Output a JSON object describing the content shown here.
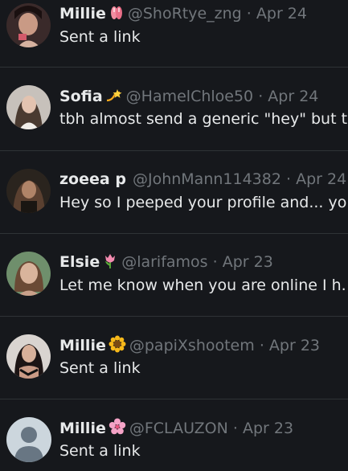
{
  "dm_list": [
    {
      "name": "Millie",
      "emoji": "flip-flops",
      "handle": "@ShoRtye_zng",
      "date": "Apr 24",
      "preview": "Sent a link"
    },
    {
      "name": "Sofia",
      "emoji": "dizzy",
      "handle": "@HamelChloe50",
      "date": "Apr 24",
      "preview": "tbh almost send a generic \"hey\" but t"
    },
    {
      "name": "zoeea p",
      "emoji": "",
      "handle": "@JohnMann114382",
      "date": "Apr 24",
      "preview": "Hey so I peeped your profile and... yo"
    },
    {
      "name": "Elsie",
      "emoji": "tulip",
      "handle": "@larifamos",
      "date": "Apr 23",
      "preview": "Let me know when you are online I h."
    },
    {
      "name": "Millie",
      "emoji": "sunflower",
      "handle": "@papiXshootem",
      "date": "Apr 23",
      "preview": "Sent a link"
    },
    {
      "name": "Millie",
      "emoji": "cherry-blossom",
      "handle": "@FCLAUZON",
      "date": "Apr 23",
      "preview": "Sent a link"
    }
  ],
  "separator": "·",
  "colors": {
    "background": "#16181c",
    "divider": "#2f3336",
    "primary_text": "#e7e9ea",
    "secondary_text": "#71767b"
  }
}
